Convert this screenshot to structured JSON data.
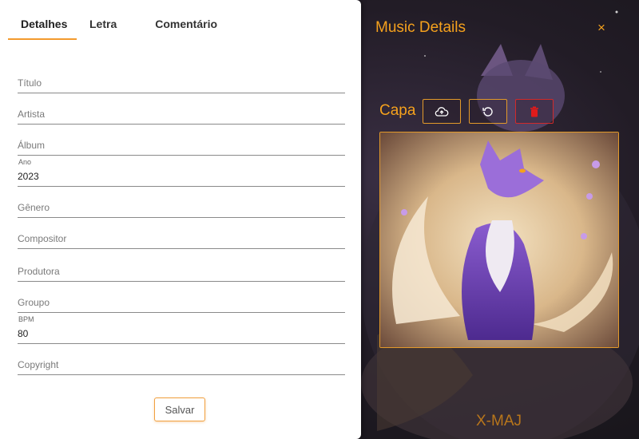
{
  "tabs": [
    {
      "label": "Detalhes",
      "active": true
    },
    {
      "label": "Letra",
      "active": false
    },
    {
      "label": "Comentário",
      "active": false
    }
  ],
  "fields": {
    "titulo": {
      "placeholder": "Título",
      "value": ""
    },
    "artista": {
      "placeholder": "Artista",
      "value": ""
    },
    "album": {
      "placeholder": "Álbum",
      "value": ""
    },
    "ano": {
      "label": "Ano",
      "value": "2023"
    },
    "genero": {
      "placeholder": "Gênero",
      "value": ""
    },
    "compositor": {
      "placeholder": "Compositor",
      "value": ""
    },
    "produtora": {
      "placeholder": "Produtora",
      "value": ""
    },
    "groupo": {
      "placeholder": "Groupo",
      "value": ""
    },
    "bpm": {
      "label": "BPM",
      "value": "80"
    },
    "copyright": {
      "placeholder": "Copyright",
      "value": ""
    }
  },
  "save_label": "Salvar",
  "panel": {
    "title": "Music Details",
    "close_glyph": "×",
    "cover_label": "Capa",
    "buttons": [
      {
        "name": "upload",
        "icon": "cloud-upload-icon"
      },
      {
        "name": "reset",
        "icon": "refresh-icon"
      },
      {
        "name": "delete",
        "icon": "trash-icon"
      }
    ],
    "brand": "X-MAJ"
  },
  "colors": {
    "accent": "#f5a11d",
    "danger": "#e01b1b",
    "tab_underline": "#f39a2e"
  }
}
